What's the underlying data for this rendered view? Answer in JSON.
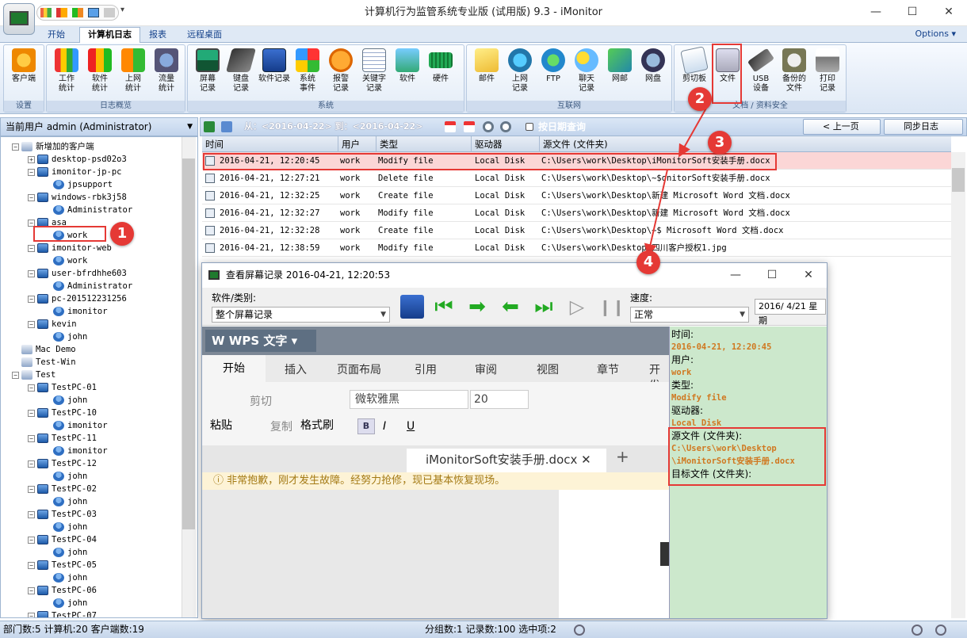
{
  "window": {
    "title": "计算机行为监管系统专业版 (试用版) 9.3 - iMonitor"
  },
  "tabs": [
    "开始",
    "计算机日志",
    "报表",
    "远程桌面"
  ],
  "options_label": "Options",
  "ribbon": {
    "groups": [
      {
        "label": "设置",
        "buttons": [
          "客户端"
        ]
      },
      {
        "label": "日志概览",
        "buttons": [
          "工作\n统计",
          "软件\n统计",
          "上网\n统计",
          "流量\n统计"
        ]
      },
      {
        "label": "系统",
        "buttons": [
          "屏幕\n记录",
          "键盘\n记录",
          "软件记录",
          "系统\n事件",
          "报警\n记录",
          "关键字\n记录",
          "软件",
          "硬件"
        ]
      },
      {
        "label": "互联网",
        "buttons": [
          "邮件",
          "上网\n记录",
          "FTP",
          "聊天\n记录",
          "网邮",
          "网盘"
        ]
      },
      {
        "label": "文档 / 资料安全",
        "buttons": [
          "剪切板",
          "文件",
          "USB\n设备",
          "备份的\n文件",
          "打印\n记录"
        ]
      }
    ]
  },
  "left_panel": {
    "header": "当前用户 admin (Administrator)",
    "tree": [
      {
        "label": "新增加的客户端",
        "level": 0,
        "type": "group",
        "exp": "-"
      },
      {
        "label": "desktop-psd02o3",
        "level": 1,
        "type": "pc",
        "exp": "+"
      },
      {
        "label": "imonitor-jp-pc",
        "level": 1,
        "type": "pc",
        "exp": "-"
      },
      {
        "label": "jpsupport",
        "level": 2,
        "type": "user"
      },
      {
        "label": "windows-rbk3j58",
        "level": 1,
        "type": "pc",
        "exp": "-"
      },
      {
        "label": "Administrator",
        "level": 2,
        "type": "user"
      },
      {
        "label": "asa",
        "level": 1,
        "type": "pc",
        "exp": "-"
      },
      {
        "label": "work",
        "level": 2,
        "type": "user"
      },
      {
        "label": "imonitor-web",
        "level": 1,
        "type": "pc",
        "exp": "-"
      },
      {
        "label": "work",
        "level": 2,
        "type": "user"
      },
      {
        "label": "user-bfrdhhe603",
        "level": 1,
        "type": "pc",
        "exp": "-"
      },
      {
        "label": "Administrator",
        "level": 2,
        "type": "user"
      },
      {
        "label": "pc-201512231256",
        "level": 1,
        "type": "pc",
        "exp": "-"
      },
      {
        "label": "imonitor",
        "level": 2,
        "type": "user"
      },
      {
        "label": "kevin",
        "level": 1,
        "type": "pc",
        "exp": "-"
      },
      {
        "label": "john",
        "level": 2,
        "type": "user"
      },
      {
        "label": "Mac Demo",
        "level": 0,
        "type": "group"
      },
      {
        "label": "Test-Win",
        "level": 0,
        "type": "group"
      },
      {
        "label": "Test",
        "level": 0,
        "type": "group",
        "exp": "-"
      },
      {
        "label": "TestPC-01",
        "level": 1,
        "type": "pc",
        "exp": "-"
      },
      {
        "label": "john",
        "level": 2,
        "type": "user"
      },
      {
        "label": "TestPC-10",
        "level": 1,
        "type": "pc",
        "exp": "-"
      },
      {
        "label": "imonitor",
        "level": 2,
        "type": "user"
      },
      {
        "label": "TestPC-11",
        "level": 1,
        "type": "pc",
        "exp": "-"
      },
      {
        "label": "imonitor",
        "level": 2,
        "type": "user"
      },
      {
        "label": "TestPC-12",
        "level": 1,
        "type": "pc",
        "exp": "-"
      },
      {
        "label": "john",
        "level": 2,
        "type": "user"
      },
      {
        "label": "TestPC-02",
        "level": 1,
        "type": "pc",
        "exp": "-"
      },
      {
        "label": "john",
        "level": 2,
        "type": "user"
      },
      {
        "label": "TestPC-03",
        "level": 1,
        "type": "pc",
        "exp": "-"
      },
      {
        "label": "john",
        "level": 2,
        "type": "user"
      },
      {
        "label": "TestPC-04",
        "level": 1,
        "type": "pc",
        "exp": "-"
      },
      {
        "label": "john",
        "level": 2,
        "type": "user"
      },
      {
        "label": "TestPC-05",
        "level": 1,
        "type": "pc",
        "exp": "-"
      },
      {
        "label": "john",
        "level": 2,
        "type": "user"
      },
      {
        "label": "TestPC-06",
        "level": 1,
        "type": "pc",
        "exp": "-"
      },
      {
        "label": "john",
        "level": 2,
        "type": "user"
      },
      {
        "label": "TestPC-07",
        "level": 1,
        "type": "pc",
        "exp": "-"
      }
    ]
  },
  "log_toolbar": {
    "date_range": "从：<2016-04-22> 到：<2016-04-22>",
    "by_date_label": "按日期查询",
    "prev_page": "< 上一页",
    "sync_log": "同步日志"
  },
  "table": {
    "columns": [
      "时间",
      "用户",
      "类型",
      "驱动器",
      "源文件 (文件夹)"
    ],
    "rows": [
      [
        "2016-04-21, 12:20:45",
        "work",
        "Modify file",
        "Local Disk",
        "C:\\Users\\work\\Desktop\\iMonitorSoft安装手册.docx"
      ],
      [
        "2016-04-21, 12:27:21",
        "work",
        "Delete file",
        "Local Disk",
        "C:\\Users\\work\\Desktop\\~$onitorSoft安装手册.docx"
      ],
      [
        "2016-04-21, 12:32:25",
        "work",
        "Create file",
        "Local Disk",
        "C:\\Users\\work\\Desktop\\新建 Microsoft Word 文档.docx"
      ],
      [
        "2016-04-21, 12:32:27",
        "work",
        "Modify file",
        "Local Disk",
        "C:\\Users\\work\\Desktop\\新建 Microsoft Word 文档.docx"
      ],
      [
        "2016-04-21, 12:32:28",
        "work",
        "Create file",
        "Local Disk",
        "C:\\Users\\work\\Desktop\\~$ Microsoft Word 文档.docx"
      ],
      [
        "2016-04-21, 12:38:59",
        "work",
        "Modify file",
        "Local Disk",
        "C:\\Users\\work\\Desktop\\四川客户授权1.jpg"
      ]
    ]
  },
  "popup": {
    "title": "查看屏幕记录 2016-04-21, 12:20:53",
    "category_label": "软件/类别:",
    "category_value": "整个屏幕记录",
    "speed_label": "速度:",
    "speed_value": "正常",
    "date_value": "2016/ 4/21 星期",
    "screen": {
      "app_name": "WPS 文字",
      "menu": [
        "开始",
        "插入",
        "页面布局",
        "引用",
        "审阅",
        "视图",
        "章节",
        "开发"
      ],
      "font_name": "微软雅黑",
      "font_size": "20",
      "cut": "剪切",
      "copy": "复制",
      "paste": "粘贴",
      "format_brush": "格式刷",
      "doc_tab": "iMonitorSoft安装手册.docx",
      "error_msg": "非常抱歉，刚才发生故障。经努力抢修，现已基本恢复现场。"
    },
    "info": {
      "time_label": "时间:",
      "time_value": "2016-04-21, 12:20:45",
      "user_label": "用户:",
      "user_value": "work",
      "type_label": "类型:",
      "type_value": "Modify file",
      "drive_label": "驱动器:",
      "drive_value": "Local Disk",
      "src_label": "源文件 (文件夹):",
      "src_value_1": "C:\\Users\\work\\Desktop",
      "src_value_2": "\\iMonitorSoft安装手册.docx",
      "dst_label": "目标文件 (文件夹):"
    }
  },
  "status": {
    "left": "部门数:5 计算机:20 客户端数:19",
    "right": "分组数:1 记录数:100 选中项:2"
  },
  "badges": [
    "1",
    "2",
    "3",
    "4"
  ],
  "colors": {
    "accent": "#e53935",
    "selected_row": "#fbd6d6",
    "info_panel": "#cce8cc"
  }
}
